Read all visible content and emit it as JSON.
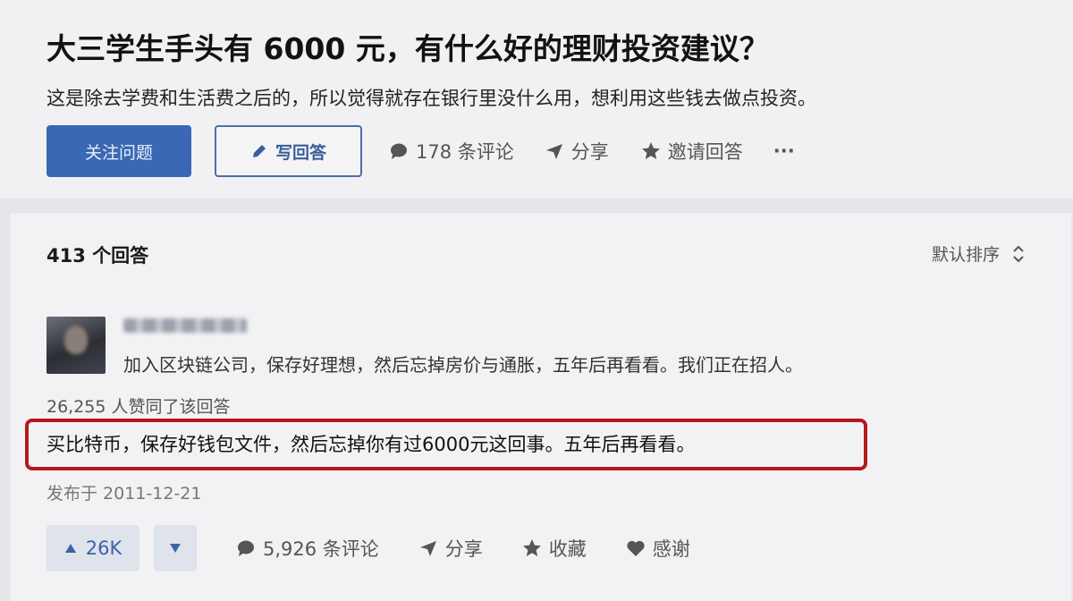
{
  "question": {
    "title": "大三学生手头有 6000 元，有什么好的理财投资建议？",
    "detail": "这是除去学费和生活费之后的，所以觉得就存在银行里没什么用，想利用这些钱去做点投资。",
    "follow_label": "关注问题",
    "write_label": "写回答",
    "comments_label": "178 条评论",
    "share_label": "分享",
    "invite_label": "邀请回答",
    "more_label": "···"
  },
  "answers": {
    "count_label": "413 个回答",
    "sort_label": "默认排序",
    "author_bio": "加入区块链公司，保存好理想，然后忘掉房价与通胀，五年后再看看。我们正在招人。",
    "votes_summary": "26,255 人赞同了该回答",
    "content": "买比特币，保存好钱包文件，然后忘掉你有过6000元这回事。五年后再看看。",
    "published": "发布于 2011-12-21",
    "upvote_label": "26K",
    "comments_label": "5,926 条评论",
    "share_label": "分享",
    "favorite_label": "收藏",
    "thanks_label": "感谢"
  },
  "colors": {
    "primary": "#3a68b4",
    "highlight_border": "#b5181b",
    "background": "#e6e6ea"
  },
  "icons": [
    "pencil-icon",
    "comment-icon",
    "share-icon",
    "star-icon",
    "more-icon",
    "sort-icon",
    "upvote-icon",
    "downvote-icon",
    "heart-icon"
  ]
}
